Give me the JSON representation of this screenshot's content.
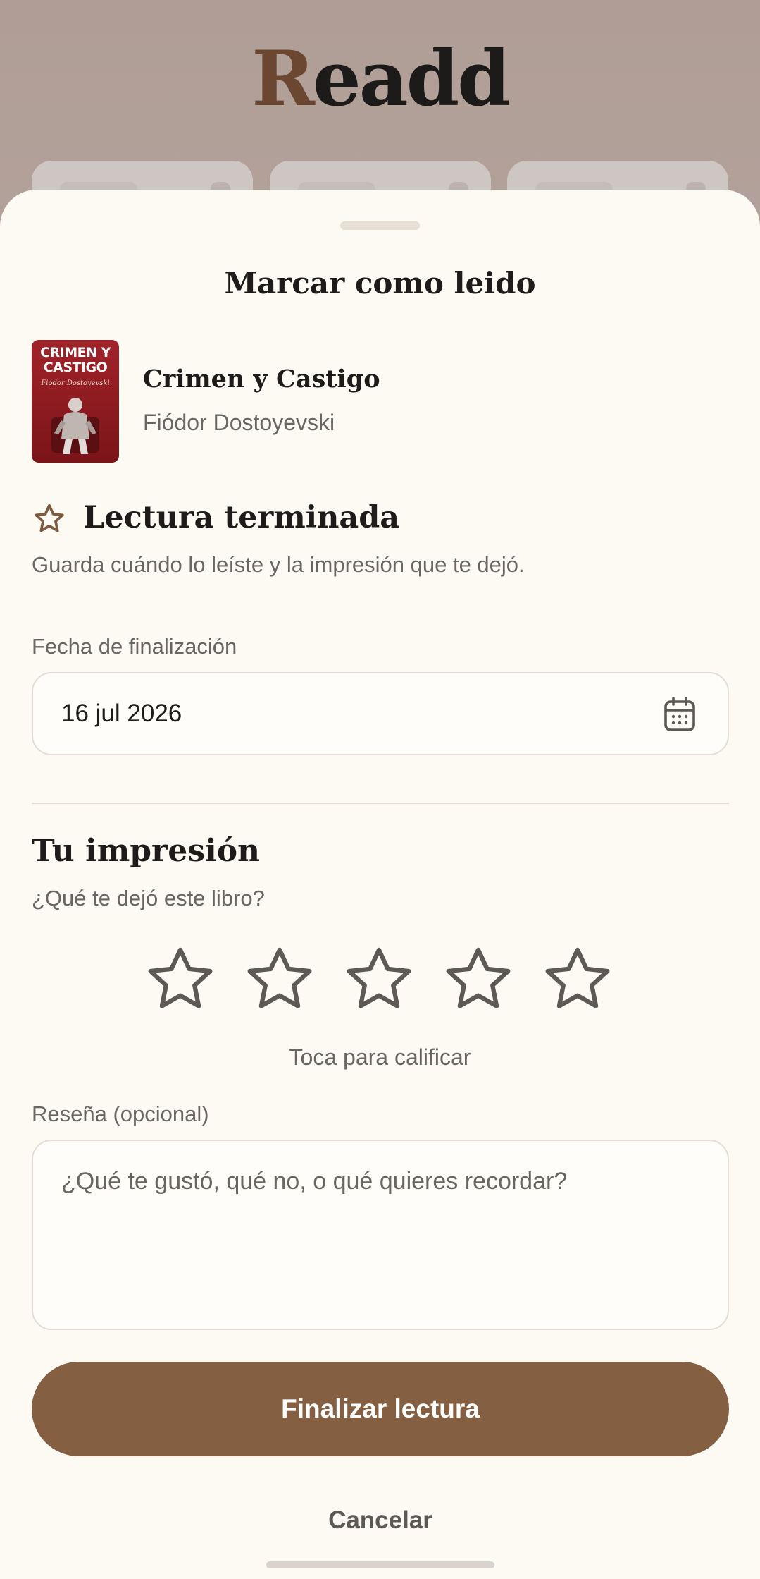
{
  "app": {
    "logo_first": "R",
    "logo_rest": "eadd"
  },
  "sheet": {
    "title": "Marcar como leido"
  },
  "book": {
    "title": "Crimen y Castigo",
    "author": "Fiódor Dostoyevski",
    "cover_title_line1": "CRIMEN Y",
    "cover_title_line2": "CASTIGO",
    "cover_author": "Fiódor Dostoyevski"
  },
  "finished": {
    "icon": "star-outline-icon",
    "title": "Lectura terminada",
    "subtitle": "Guarda cuándo lo leíste y la impresión que te dejó."
  },
  "date": {
    "label": "Fecha de finalización",
    "value": "16 jul 2026",
    "icon": "calendar-icon"
  },
  "impression": {
    "title": "Tu impresión",
    "subtitle": "¿Qué te dejó este libro?",
    "rating": 0,
    "max_rating": 5,
    "hint": "Toca para calificar"
  },
  "review": {
    "label": "Reseña (opcional)",
    "placeholder": "¿Qué te gustó, qué no, o qué quieres recordar?"
  },
  "actions": {
    "primary": "Finalizar lectura",
    "cancel": "Cancelar"
  },
  "colors": {
    "accent": "#845f42",
    "sheet_bg": "#fdfaf4",
    "text_primary": "#1e1c1a",
    "text_secondary": "#6b6561",
    "border": "#e5ddd3"
  }
}
